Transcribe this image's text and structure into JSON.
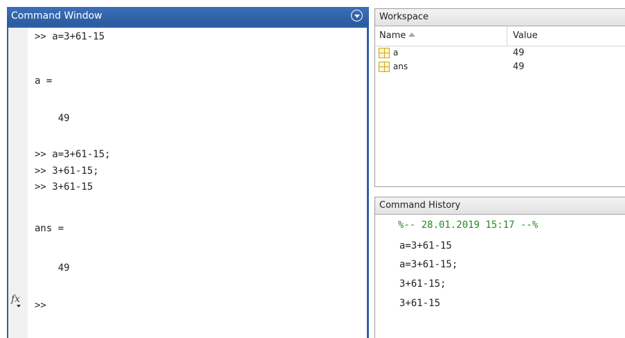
{
  "command_window": {
    "title": "Command Window",
    "lines": [
      ">> a=3+61-15",
      "a =",
      "    49",
      ">> a=3+61-15;",
      ">> 3+61-15;",
      ">> 3+61-15",
      "ans =",
      "    49",
      ">>"
    ]
  },
  "workspace": {
    "title": "Workspace",
    "columns": {
      "name": "Name",
      "value": "Value"
    },
    "variables": [
      {
        "name": "a",
        "value": "49"
      },
      {
        "name": "ans",
        "value": "49"
      }
    ]
  },
  "command_history": {
    "title": "Command History",
    "session_header": "%-- 28.01.2019 15:17 --%",
    "entries": [
      "a=3+61-15",
      "a=3+61-15;",
      "3+61-15;",
      "3+61-15"
    ]
  },
  "colors": {
    "command_window_accent": "#2f5fa6",
    "history_session_header": "#228b22"
  },
  "icons": {
    "cmd_menu": "circle-chevron-down-icon",
    "fx": "function-browser-icon",
    "variable": "variable-grid-icon",
    "sort": "sort-ascending-icon"
  }
}
